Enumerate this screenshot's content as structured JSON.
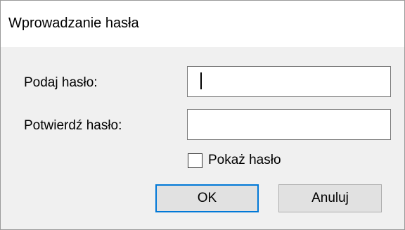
{
  "window": {
    "title": "Wprowadzanie hasła"
  },
  "form": {
    "password_label": "Podaj hasło:",
    "password_value": "",
    "confirm_label": "Potwierdź hasło:",
    "confirm_value": "",
    "show_password_label": "Pokaż hasło",
    "show_password_checked": false
  },
  "buttons": {
    "ok_label": "OK",
    "cancel_label": "Anuluj"
  },
  "colors": {
    "background": "#f0f0f0",
    "titlebar": "#ffffff",
    "default_button_border": "#0078d7"
  }
}
